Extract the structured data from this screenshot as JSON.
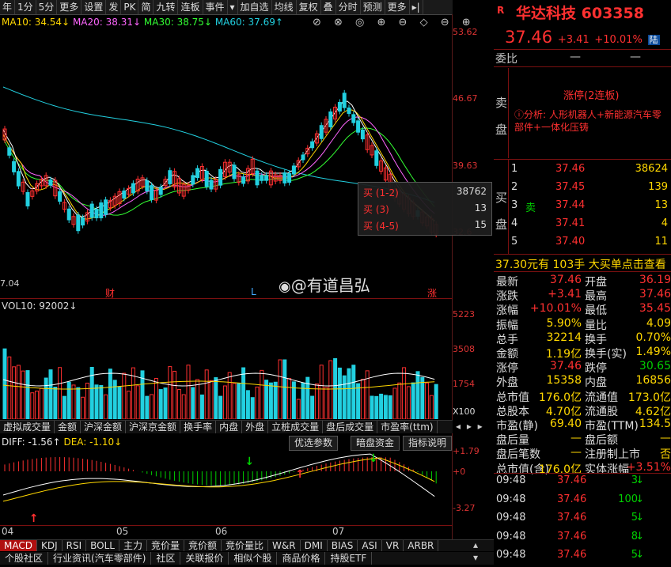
{
  "toolbar": [
    "年",
    "1分",
    "5分",
    "更多",
    "设置",
    "发",
    "PK",
    "简",
    "九转",
    "连板",
    "事件",
    "▾",
    "加自选",
    "均线",
    "复权",
    "叠",
    "分时",
    "预测",
    "更多",
    "▸|"
  ],
  "ma": {
    "ma10": "MA10: 34.54↓",
    "ma20": "MA20: 38.31↓",
    "ma30": "MA30: 38.75↓",
    "ma60": "MA60: 37.69↑"
  },
  "price_axis": [
    "53.62",
    "46.67",
    "39.63",
    "32.6"
  ],
  "date_label": "7.04",
  "markers": {
    "cai": "财",
    "l": "L",
    "zhang": "涨"
  },
  "watermark": "@有道昌弘",
  "vol": {
    "label": "VOL10: 92002↓",
    "axis": [
      "5223",
      "3508",
      "1754",
      "X100"
    ]
  },
  "ind_tabs": [
    "虚拟成交量",
    "金额",
    "沪深金额",
    "沪深京金额",
    "换手率",
    "内盘",
    "外盘",
    "立桩成交量",
    "盘后成交量",
    "市盈率(ttm)"
  ],
  "macd_line": {
    "dif": "DIFF: -1.56↑",
    "dea": "DEA: -1.10↓"
  },
  "macd_buttons": [
    "优选参数",
    "暗盘资金",
    "指标说明"
  ],
  "macd_axis": [
    "+1.79",
    "+0",
    "-3.27"
  ],
  "months": [
    "04",
    "05",
    "06",
    "07"
  ],
  "tabbar": [
    "MACD",
    "KDJ",
    "RSI",
    "BOLL",
    "主力",
    "竞价量",
    "竞价额",
    "竞价量比",
    "W&R",
    "DMI",
    "BIAS",
    "ASI",
    "VR",
    "ARBR"
  ],
  "bottom": [
    "个股社区",
    "行业资讯(汽车零部件)",
    "社区",
    "关联报价",
    "相似个股",
    "商品价格",
    "持股ETF"
  ],
  "popup": [
    {
      "label": "买 (1-2)",
      "value": "38762"
    },
    {
      "label": "买 (3)",
      "value": "13"
    },
    {
      "label": "买 (4-5)",
      "value": "15"
    }
  ],
  "stock": {
    "icon": "R",
    "name": "华达科技",
    "code": "603358",
    "price": "37.46",
    "change": "+3.41",
    "pct": "+10.01%",
    "tag": "陆"
  },
  "weibi": {
    "label": "委比",
    "v1": "—",
    "v2": "—"
  },
  "sell_label": "卖\n盘",
  "limit_title": "涨停(2连板)",
  "analysis": "分析: 人形机器人+新能源汽车零部件+一体化压铸",
  "buy_label": "买\n盘",
  "buys": [
    {
      "n": "1",
      "p": "37.46",
      "v": "38624",
      "tag": ""
    },
    {
      "n": "2",
      "p": "37.45",
      "v": "139",
      "tag": ""
    },
    {
      "n": "3",
      "p": "37.44",
      "v": "13",
      "tag": "卖"
    },
    {
      "n": "4",
      "p": "37.41",
      "v": "4",
      "tag": ""
    },
    {
      "n": "5",
      "p": "37.40",
      "v": "11",
      "tag": ""
    }
  ],
  "big_order": "37.30元有 103手 大买单点击查看",
  "stats": [
    [
      "最新",
      "37.46",
      "开盘",
      "36.19"
    ],
    [
      "涨跌",
      "+3.41",
      "最高",
      "37.46"
    ],
    [
      "涨幅",
      "+10.01%",
      "最低",
      "35.45"
    ],
    [
      "振幅",
      "5.90%",
      "量比",
      "4.09"
    ],
    [
      "总手",
      "32214",
      "换手",
      "0.70%"
    ],
    [
      "金额",
      "1.19亿",
      "换手(实)",
      "1.49%"
    ],
    [
      "涨停",
      "37.46",
      "跌停",
      "30.65"
    ],
    [
      "外盘",
      "15358",
      "内盘",
      "16856"
    ],
    [
      "总市值",
      "176.0亿",
      "流通值",
      "173.0亿"
    ],
    [
      "总股本",
      "4.70亿",
      "流通股",
      "4.62亿"
    ],
    [
      "市盈(静)",
      "69.40",
      "市盈(TTM)",
      "134.5"
    ],
    [
      "盘后量",
      "—",
      "盘后额",
      "—"
    ],
    [
      "盘后笔数",
      "—",
      "注册制上市",
      "否"
    ],
    [
      "总市值(含)",
      "176.0亿",
      "实体涨幅",
      "+3.51%"
    ]
  ],
  "ticks": [
    {
      "t": "09:48",
      "p": "37.46",
      "v": "3"
    },
    {
      "t": "09:48",
      "p": "37.46",
      "v": "100"
    },
    {
      "t": "09:48",
      "p": "37.46",
      "v": "5"
    },
    {
      "t": "09:48",
      "p": "37.46",
      "v": "8"
    },
    {
      "t": "09:48",
      "p": "37.46",
      "v": "5"
    }
  ]
}
